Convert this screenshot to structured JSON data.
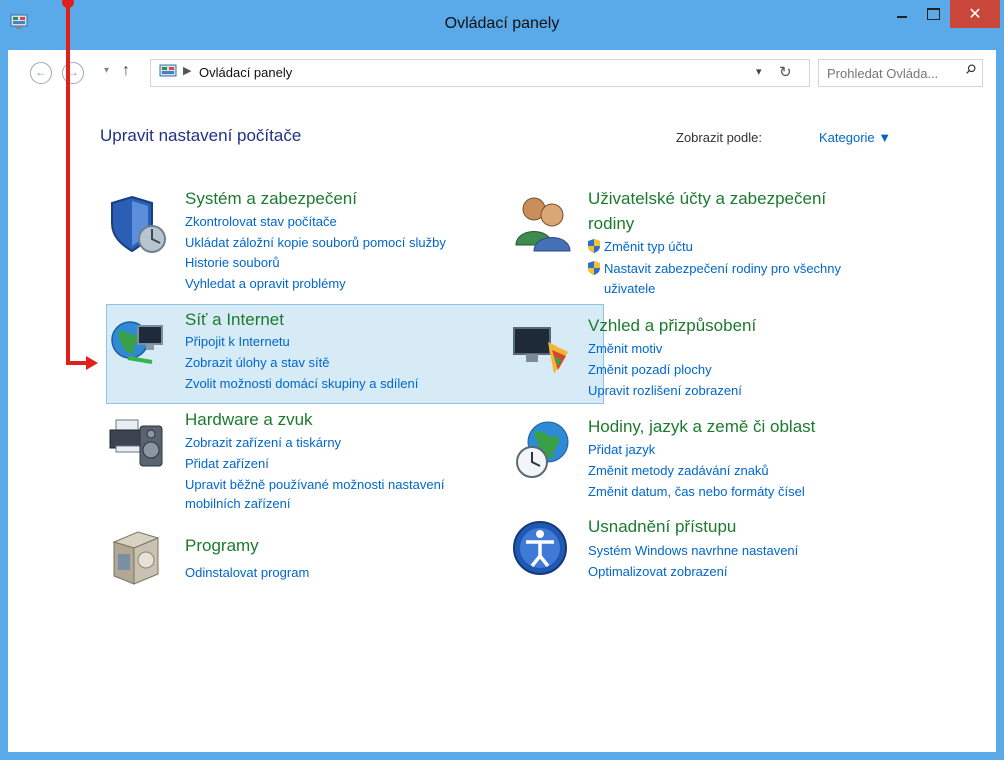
{
  "window": {
    "title": "Ovládací panely"
  },
  "nav": {
    "back_icon": "back-arrow-icon",
    "forward_icon": "forward-arrow-icon",
    "up_icon": "up-arrow-icon",
    "breadcrumb": "Ovládací panely",
    "search_placeholder": "Prohledat Ovláda..."
  },
  "header": {
    "title": "Upravit nastavení počítače",
    "view_by_label": "Zobrazit podle:",
    "view_by_value": "Kategorie"
  },
  "categories": [
    {
      "title": "Systém a zabezpečení",
      "icon": "security-shield-icon",
      "links": [
        "Zkontrolovat stav počítače",
        "Ukládat záložní kopie souborů pomocí služby",
        "Historie souborů",
        "Vyhledat a opravit problémy"
      ]
    },
    {
      "title": "Síť a Internet",
      "icon": "network-globe-icon",
      "links": [
        "Připojit k Internetu",
        "Zobrazit úlohy a stav sítě",
        "Zvolit možnosti domácí skupiny a sdílení"
      ]
    },
    {
      "title": "Hardware a zvuk",
      "icon": "printer-speaker-icon",
      "links": [
        "Zobrazit zařízení a tiskárny",
        "Přidat zařízení",
        "Upravit běžně používané možnosti nastavení",
        "mobilních zařízení"
      ]
    },
    {
      "title": "Programy",
      "icon": "programs-box-icon",
      "links": [
        "Odinstalovat program"
      ]
    },
    {
      "title": "Uživatelské účty a zabezpečení",
      "title2": "rodiny",
      "icon": "users-icon",
      "links": [
        "Změnit typ účtu",
        "Nastavit zabezpečení rodiny pro všechny",
        "uživatele"
      ]
    },
    {
      "title": "Vzhled a přizpůsobení",
      "icon": "appearance-monitor-icon",
      "links": [
        "Změnit motiv",
        "Změnit pozadí plochy",
        "Upravit rozlišení zobrazení"
      ]
    },
    {
      "title": "Hodiny, jazyk a země či oblast",
      "icon": "clock-globe-icon",
      "links": [
        "Přidat jazyk",
        "Změnit metody zadávání znaků",
        "Změnit datum, čas nebo formáty čísel"
      ]
    },
    {
      "title": "Usnadnění přístupu",
      "icon": "accessibility-icon",
      "links": [
        "Systém Windows navrhne nastavení",
        "Optimalizovat zobrazení"
      ]
    }
  ],
  "colors": {
    "title_bar": "#5aa9e8",
    "close_button": "#c9473a",
    "category_title": "#1c7a2e",
    "link": "#0066cc",
    "annotation": "#e0201b"
  }
}
